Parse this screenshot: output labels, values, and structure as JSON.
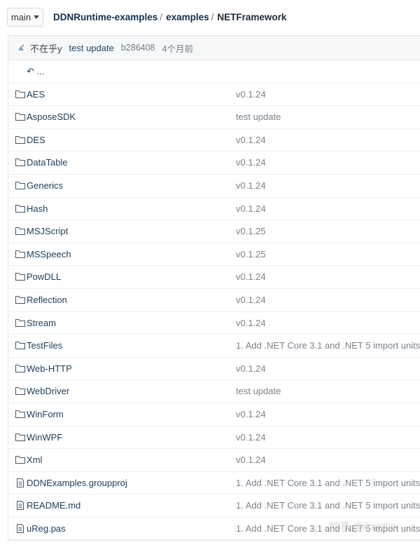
{
  "branch": {
    "label": "main"
  },
  "breadcrumb": {
    "items": [
      "DDNRuntime-examples",
      "examples",
      "NETFramework"
    ]
  },
  "commit": {
    "author": "不在乎y",
    "message": "test update",
    "sha": "b286408",
    "time": "4个月前"
  },
  "parent_link": "...",
  "files": [
    {
      "name": "AES",
      "type": "folder",
      "message": "v0.1.24"
    },
    {
      "name": "AsposeSDK",
      "type": "folder",
      "message": "test update"
    },
    {
      "name": "DES",
      "type": "folder",
      "message": "v0.1.24"
    },
    {
      "name": "DataTable",
      "type": "folder",
      "message": "v0.1.24"
    },
    {
      "name": "Generics",
      "type": "folder",
      "message": "v0.1.24"
    },
    {
      "name": "Hash",
      "type": "folder",
      "message": "v0.1.24"
    },
    {
      "name": "MSJScript",
      "type": "folder",
      "message": "v0.1.25"
    },
    {
      "name": "MSSpeech",
      "type": "folder",
      "message": "v0.1.25"
    },
    {
      "name": "PowDLL",
      "type": "folder",
      "message": "v0.1.24"
    },
    {
      "name": "Reflection",
      "type": "folder",
      "message": "v0.1.24"
    },
    {
      "name": "Stream",
      "type": "folder",
      "message": "v0.1.24"
    },
    {
      "name": "TestFiles",
      "type": "folder",
      "message": "1. Add .NET Core 3.1 and .NET 5 import units."
    },
    {
      "name": "Web-HTTP",
      "type": "folder",
      "message": "v0.1.24"
    },
    {
      "name": "WebDriver",
      "type": "folder",
      "message": "test update"
    },
    {
      "name": "WinForm",
      "type": "folder",
      "message": "v0.1.24"
    },
    {
      "name": "WinWPF",
      "type": "folder",
      "message": "v0.1.24"
    },
    {
      "name": "Xml",
      "type": "folder",
      "message": "v0.1.24"
    },
    {
      "name": "DDNExamples.groupproj",
      "type": "file",
      "message": "1. Add .NET Core 3.1 and .NET 5 import units."
    },
    {
      "name": "README.md",
      "type": "file",
      "message": "1. Add .NET Core 3.1 and .NET 5 import units."
    },
    {
      "name": "uReg.pas",
      "type": "file",
      "message": "1. Add .NET Core 3.1 and .NET 5 import units."
    }
  ],
  "watermark": "知乎 @KngStr",
  "colors": {
    "link": "#1c3e5b",
    "muted": "#7a838b",
    "header_bg": "#f5f7f9"
  }
}
